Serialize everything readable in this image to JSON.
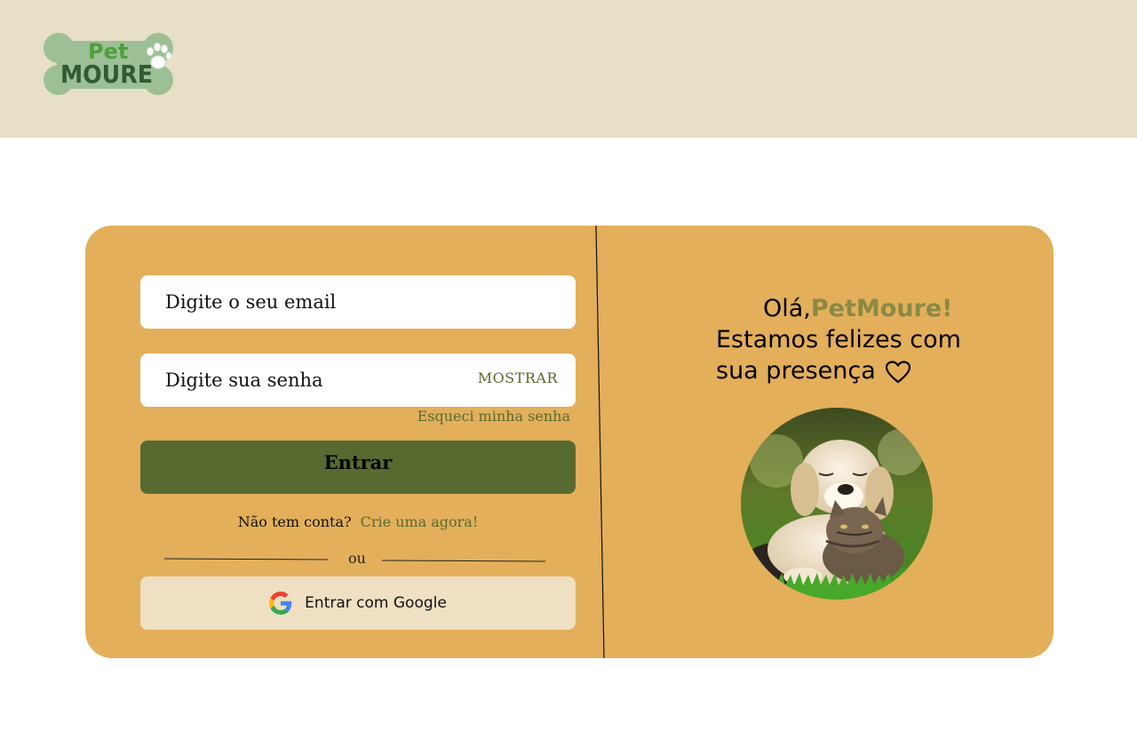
{
  "brand": {
    "logo_top": "Pet",
    "logo_bottom": "MOURE"
  },
  "login": {
    "email_placeholder": "Digite o seu email",
    "password_placeholder": "Digite sua senha",
    "show_label": "MOSTRAR",
    "forgot_label": "Esqueci minha senha",
    "submit_label": "Entrar",
    "no_account_text": "Não tem conta?",
    "signup_link": "Crie uma agora!",
    "or_text": "ou",
    "google_label": "Entrar com Google"
  },
  "welcome": {
    "hello": "Olá,",
    "brand_name": "PetMoure!",
    "line2": "Estamos felizes com",
    "line3": "sua presença"
  },
  "colors": {
    "header_bg": "#e7e0c7",
    "card_bg": "#e3af5b",
    "accent_green": "#576b30",
    "brand_olive": "#8a8945",
    "google_btn_bg": "#efdfc3",
    "logo_bone": "#9dbf96",
    "logo_text": "#2f5a32"
  },
  "icons": {
    "heart": "heart-outline-icon",
    "google": "google-g-icon",
    "logo_paw": "paw-icon"
  }
}
